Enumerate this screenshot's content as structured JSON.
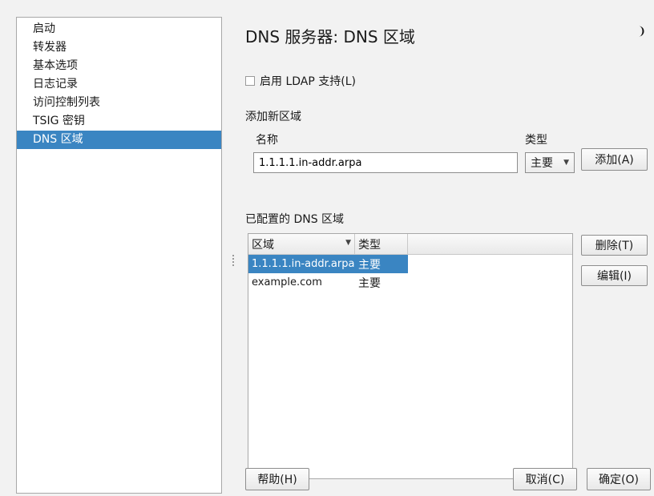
{
  "sidebar": {
    "items": [
      {
        "label": "启动"
      },
      {
        "label": "转发器"
      },
      {
        "label": "基本选项"
      },
      {
        "label": "日志记录"
      },
      {
        "label": "访问控制列表"
      },
      {
        "label": "TSIG 密钥"
      },
      {
        "label": "DNS 区域",
        "active": true
      }
    ]
  },
  "header": {
    "title": "DNS 服务器: DNS 区域",
    "theme_icon": "moon-icon"
  },
  "ldap": {
    "label": "启用 LDAP 支持(L)",
    "checked": false
  },
  "add_zone": {
    "section_label": "添加新区域",
    "name_label": "名称",
    "type_label": "类型",
    "name_value": "1.1.1.1.in-addr.arpa",
    "type_value": "主要",
    "add_button": "添加(A)"
  },
  "configured": {
    "section_label": "已配置的 DNS 区域",
    "columns": [
      "区域",
      "类型"
    ],
    "rows": [
      {
        "zone": "1.1.1.1.in-addr.arpa",
        "type": "主要",
        "selected": true
      },
      {
        "zone": "example.com",
        "type": "主要",
        "selected": false
      }
    ],
    "delete_button": "删除(T)",
    "edit_button": "编辑(I)"
  },
  "footer": {
    "help_button": "帮助(H)",
    "cancel_button": "取消(C)",
    "ok_button": "确定(O)"
  },
  "colors": {
    "selection": "#3a85c2",
    "window_bg": "#f2f2f2"
  }
}
